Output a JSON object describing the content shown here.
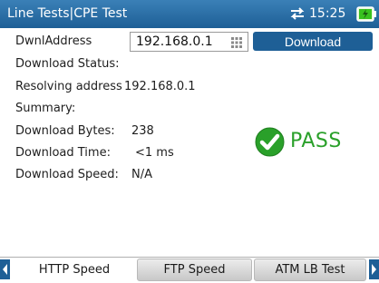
{
  "header": {
    "title": "Line Tests|CPE Test",
    "time": "15:25",
    "net_icon": "network-transfer-icon",
    "battery_icon": "battery-charging-icon"
  },
  "form": {
    "address_label": "DwnlAddress",
    "address_value": "192.168.0.1",
    "keypad_icon": "keypad-icon",
    "download_button": "Download"
  },
  "status": {
    "download_status_label": "Download Status:",
    "resolving_label": "Resolving address",
    "resolving_value": "192.168.0.1",
    "summary_label": "Summary:",
    "bytes_label": "Download Bytes:",
    "bytes_value": "238",
    "time_label": "Download Time:",
    "time_value": "<1 ms",
    "speed_label": "Download Speed:",
    "speed_value": "N/A"
  },
  "result": {
    "text": "PASS",
    "icon": "check-circle-icon",
    "color": "#2aa02a"
  },
  "tabs": [
    {
      "label": "HTTP Speed",
      "active": true
    },
    {
      "label": "FTP Speed",
      "active": false
    },
    {
      "label": "ATM LB Test",
      "active": false
    }
  ],
  "colors": {
    "accent": "#1e5f96",
    "pass": "#2aa02a"
  }
}
